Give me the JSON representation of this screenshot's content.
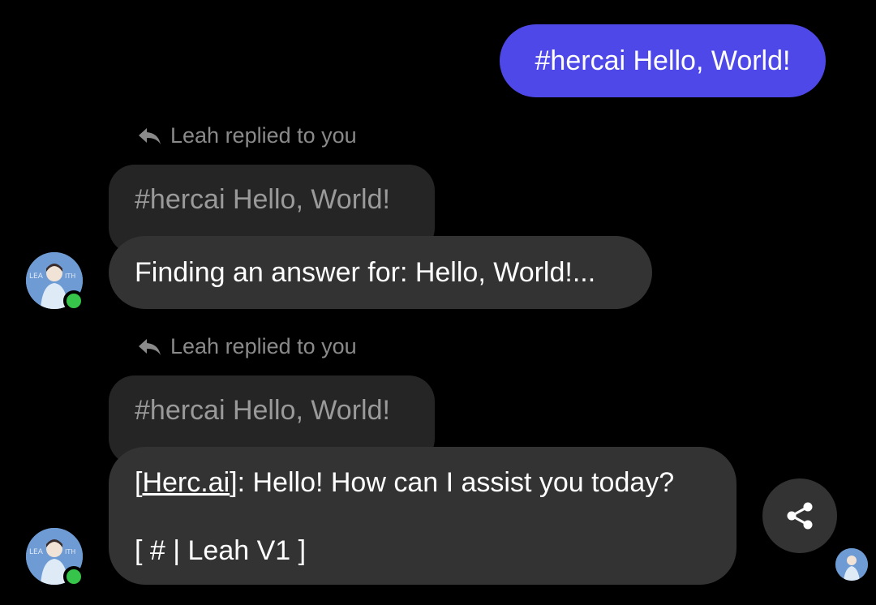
{
  "colors": {
    "sent_bubble": "#4e48e8",
    "received_bubble": "#333333",
    "quoted_bubble": "#252525",
    "online": "#37c44a"
  },
  "sent_message": {
    "text": "#hercai Hello, World!"
  },
  "messages": [
    {
      "reply_header": "Leah replied to you",
      "quoted_text": "#hercai Hello, World!",
      "text": "Finding an answer for: Hello, World!..."
    },
    {
      "reply_header": "Leah replied to you",
      "quoted_text": "#hercai Hello, World!",
      "link_text": "Herc.ai",
      "text_open": "[",
      "text_after_link": "]: Hello! How can I assist you today?",
      "signature": "[ # | Leah V1 ]"
    }
  ],
  "icons": {
    "reply": "reply-arrow-icon",
    "share": "share-icon",
    "online": "online-status-dot"
  },
  "avatar_lettering": "LEAH SMITH"
}
